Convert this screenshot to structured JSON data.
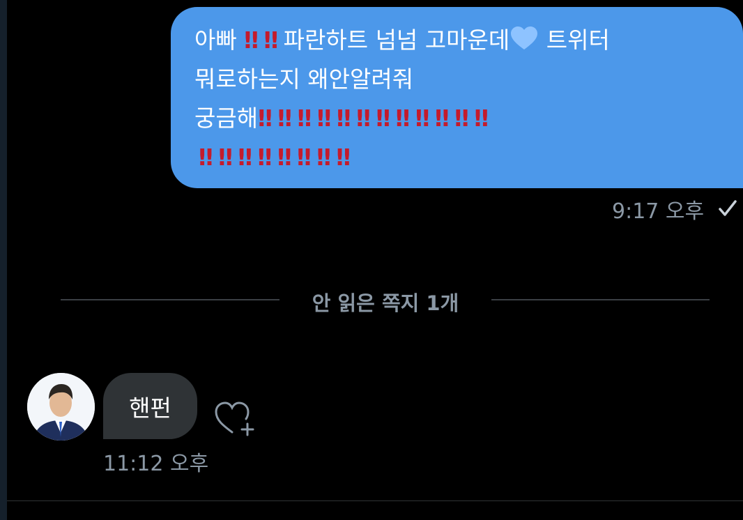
{
  "colors": {
    "background": "#000000",
    "sent_bubble": "#4c98ea",
    "received_bubble": "#2f3336",
    "secondary_text": "#8b98a5",
    "emoji_red": "#c41b2c"
  },
  "sent_message": {
    "line1_a": "아빠",
    "line1_b": "파란하트 넘넘 고마운데",
    "line1_c": "트위터",
    "line2": "뭐로하는지 왜안알려줘",
    "line3": "궁금해",
    "emoji_double_exclamation": "‼",
    "emoji_blue_heart": "blue-heart-emoji",
    "time": "9:17 오후"
  },
  "unread_divider": {
    "label": "안 읽은 쪽지 1개"
  },
  "received_message": {
    "text": "핸펀",
    "time": "11:12 오후"
  },
  "icons": {
    "read_receipt": "checkmark-icon",
    "react": "heart-plus-icon",
    "avatar": "profile-photo"
  }
}
